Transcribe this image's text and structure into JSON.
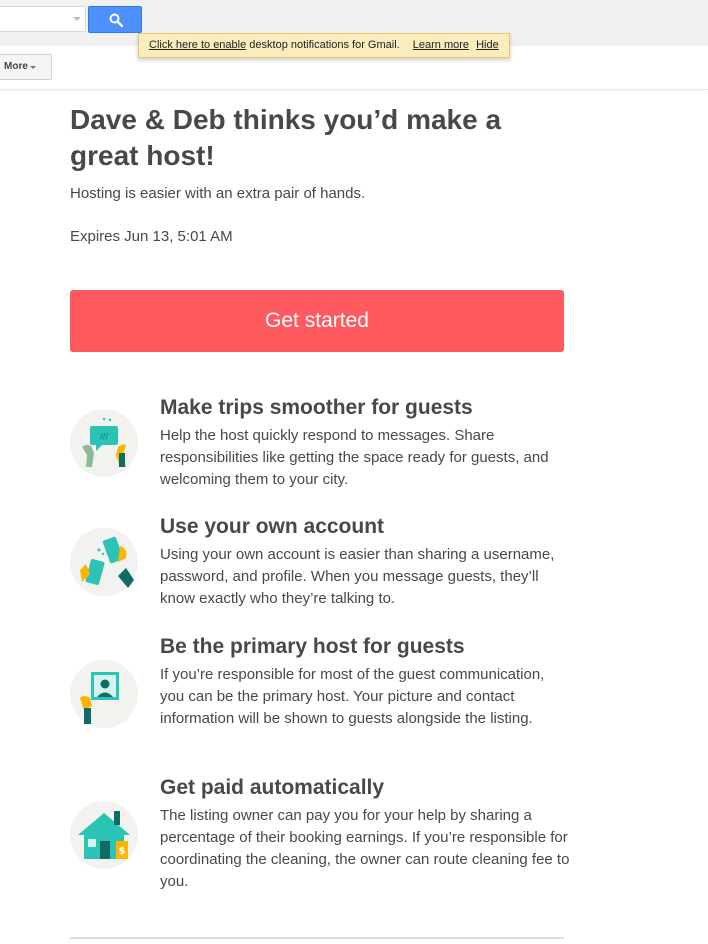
{
  "gmail": {
    "search_placeholder": "",
    "notice": {
      "enable_link": "Click here to enable",
      "message": "desktop notifications for Gmail.",
      "learn_more": "Learn more",
      "hide": "Hide"
    },
    "toolbar": {
      "more_label": "More"
    }
  },
  "email": {
    "headline": "Dave & Deb thinks you’d make a great host!",
    "subtitle": "Hosting is easier with an extra pair of hands.",
    "expires": "Expires Jun 13, 5:01 AM",
    "cta_label": "Get started",
    "features": [
      {
        "icon": "chat-bubble-hands-icon",
        "title": "Make trips smoother for guests",
        "body": "Help the host quickly respond to messages. Share responsibilities like getting the space ready for guests, and welcoming them to your city."
      },
      {
        "icon": "phones-exchange-icon",
        "title": "Use your own account",
        "body": "Using your own account is easier than sharing a username, password, and profile. When you message guests, they’ll know exactly who they’re talking to."
      },
      {
        "icon": "profile-picture-icon",
        "title": "Be the primary host for guests",
        "body": "If you’re responsible for most of the guest communication, you can be the primary host. Your picture and contact information will be shown to guests alongside the listing."
      },
      {
        "icon": "house-payment-icon",
        "title": "Get paid automatically",
        "body": "The listing owner can pay you for your help by sharing a percentage of their booking earnings. If you’re responsible for coordinating the cleaning, the owner can route cleaning fee to you."
      }
    ]
  },
  "colors": {
    "cta": "#ff5a5f",
    "teal": "#2ac3b5",
    "dark_teal": "#0f6b63",
    "yellow": "#ffb400",
    "notice_bg": "#f9edbe",
    "gmail_blue": "#4d90fe"
  }
}
